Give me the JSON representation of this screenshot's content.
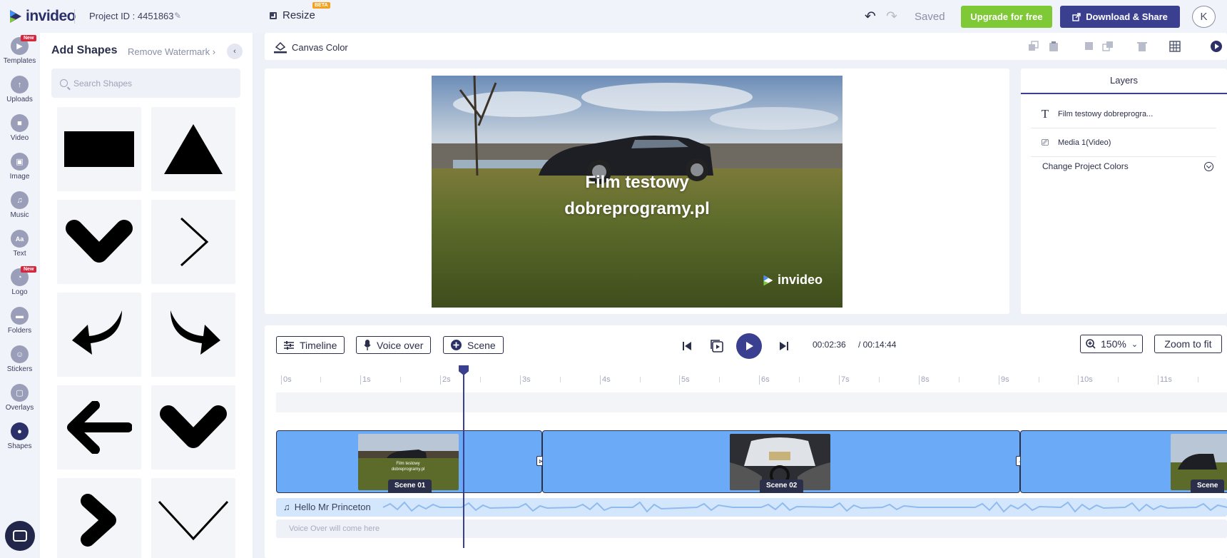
{
  "header": {
    "logo_text": "invideo",
    "project_id": "Project ID : 4451863",
    "resize_label": "Resize",
    "beta_badge": "BETA",
    "saved_label": "Saved",
    "upgrade_label": "Upgrade for free",
    "download_label": "Download & Share",
    "avatar_initial": "K"
  },
  "rail": {
    "new_badge": "New",
    "items": [
      {
        "label": "Templates",
        "icon": "templates-icon"
      },
      {
        "label": "Uploads",
        "icon": "uploads-icon"
      },
      {
        "label": "Video",
        "icon": "video-icon"
      },
      {
        "label": "Image",
        "icon": "image-icon"
      },
      {
        "label": "Music",
        "icon": "music-icon"
      },
      {
        "label": "Text",
        "icon": "text-icon"
      },
      {
        "label": "Logo",
        "icon": "logo-icon"
      },
      {
        "label": "Folders",
        "icon": "folders-icon"
      },
      {
        "label": "Stickers",
        "icon": "stickers-icon"
      },
      {
        "label": "Overlays",
        "icon": "overlays-icon"
      },
      {
        "label": "Shapes",
        "icon": "shapes-icon"
      }
    ],
    "text_glyph": "Aa"
  },
  "panel": {
    "title": "Add Shapes",
    "remove_watermark": "Remove Watermark",
    "search_placeholder": "Search Shapes",
    "shapes": [
      "rectangle",
      "triangle",
      "chevron-down-bold",
      "chevron-right-thin",
      "arrow-curved-left",
      "arrow-curved-right",
      "arrow-left",
      "chevron-down-bold",
      "chevron-right-bold",
      "chevron-down-thin"
    ]
  },
  "canvas": {
    "canvas_color_label": "Canvas Color",
    "title_line1": "Film testowy",
    "title_line2": "dobreprogramy.pl",
    "watermark": "invideo"
  },
  "layers": {
    "tab_label": "Layers",
    "items": [
      {
        "label": "Film testowy dobreprogra...",
        "icon": "text-layer-icon"
      },
      {
        "label": "Media 1(Video)",
        "icon": "video-layer-icon"
      }
    ],
    "change_colors": "Change Project Colors"
  },
  "timeline": {
    "timeline_btn": "Timeline",
    "voiceover_btn": "Voice over",
    "scene_btn": "Scene",
    "current_time": "00:02:36",
    "total_time": "/ 00:14:44",
    "zoom_level": "150%",
    "zoom_fit": "Zoom to fit",
    "ticks": [
      "0s",
      "1s",
      "2s",
      "3s",
      "4s",
      "5s",
      "6s",
      "7s",
      "8s",
      "9s",
      "10s",
      "11s"
    ],
    "scenes": [
      "Scene 01",
      "Scene 02",
      "Scene"
    ],
    "audio_track": "Hello Mr Princeton",
    "voice_placeholder": "Voice Over will come here"
  }
}
